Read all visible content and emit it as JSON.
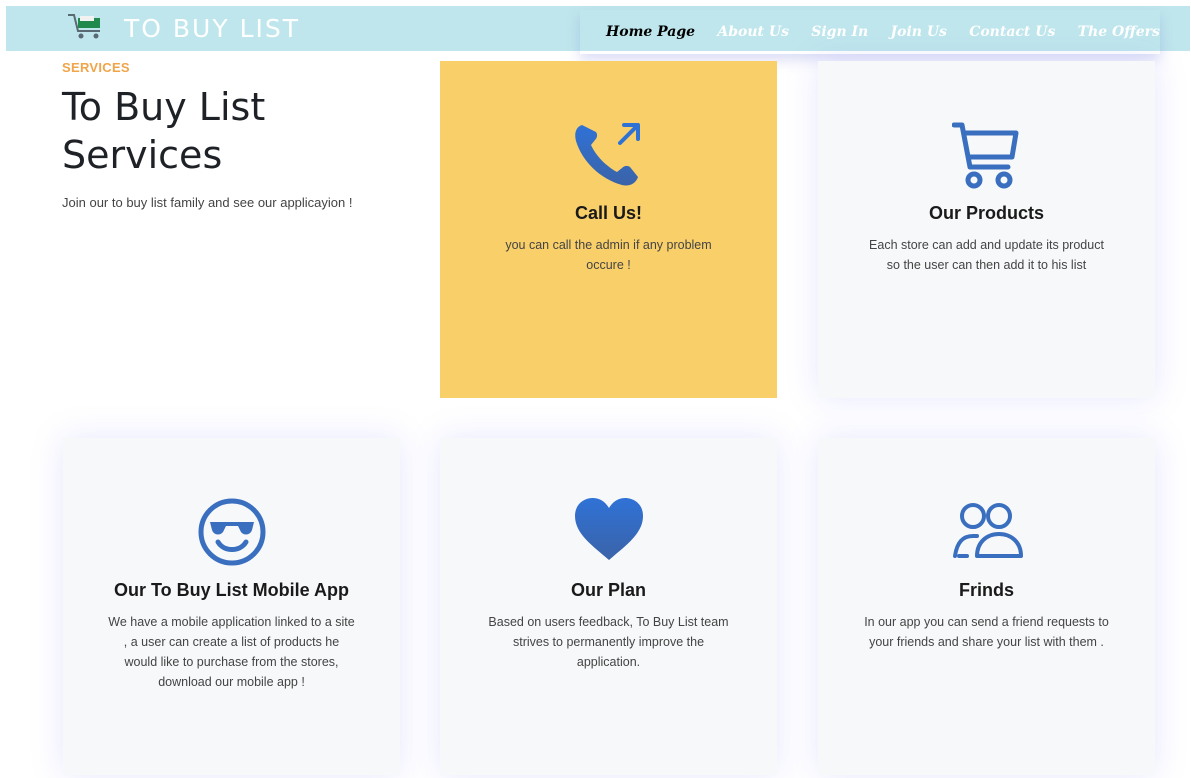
{
  "brand": {
    "title": "TO BUY LIST",
    "icon": "shopping-cart-icon"
  },
  "nav": [
    {
      "label": "Home Page",
      "active": true
    },
    {
      "label": "About Us"
    },
    {
      "label": "Sign In"
    },
    {
      "label": "Join Us"
    },
    {
      "label": "Contact Us"
    },
    {
      "label": "The Offers"
    }
  ],
  "intro": {
    "label": "SERVICES",
    "title": "To Buy List Services",
    "text": "Join our to buy list family and see our applicayion !"
  },
  "cards": [
    {
      "icon": "phone-outgoing-icon",
      "title": "Call Us!",
      "text": "you can call the admin if any problem occure !"
    },
    {
      "icon": "cart-icon",
      "title": "Our Products",
      "text": "Each store can add and update its product so the user can then add it to his list"
    },
    {
      "icon": "sunglasses-smile-icon",
      "title": "Our To Buy List Mobile App",
      "text": "We have a mobile application linked to a site , a user can create a list of products he would like to purchase from the stores, download our mobile app !"
    },
    {
      "icon": "heart-icon",
      "title": "Our Plan",
      "text": "Based on users feedback, To Buy List team strives to permanently improve the application."
    },
    {
      "icon": "people-icon",
      "title": "Frinds",
      "text": "In our app you can send a friend requests to your friends and share your list with them ."
    }
  ],
  "colors": {
    "navbar": "#bfe6ec",
    "accent": "#f0a54a",
    "highlight": "#f9cf6a",
    "icon_blue": "#2f72d6"
  }
}
